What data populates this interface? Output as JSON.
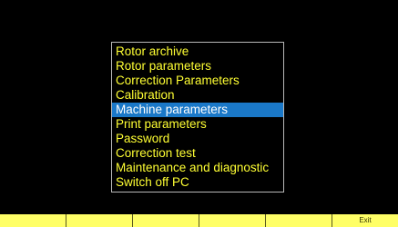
{
  "menu": {
    "items": [
      {
        "label": "Rotor archive"
      },
      {
        "label": "Rotor parameters"
      },
      {
        "label": "Correction Parameters"
      },
      {
        "label": "Calibration"
      },
      {
        "label": "Machine parameters",
        "selected": true
      },
      {
        "label": "Print parameters"
      },
      {
        "label": "Password"
      },
      {
        "label": "Correction test"
      },
      {
        "label": "Maintenance and diagnostic"
      },
      {
        "label": "Switch off PC"
      }
    ]
  },
  "function_keys": [
    "",
    "",
    "",
    "",
    "",
    "Exit"
  ],
  "colors": {
    "background": "#000000",
    "menu_text": "#ffff33",
    "selection": "#1a78c8",
    "function_key": "#ffff66"
  }
}
